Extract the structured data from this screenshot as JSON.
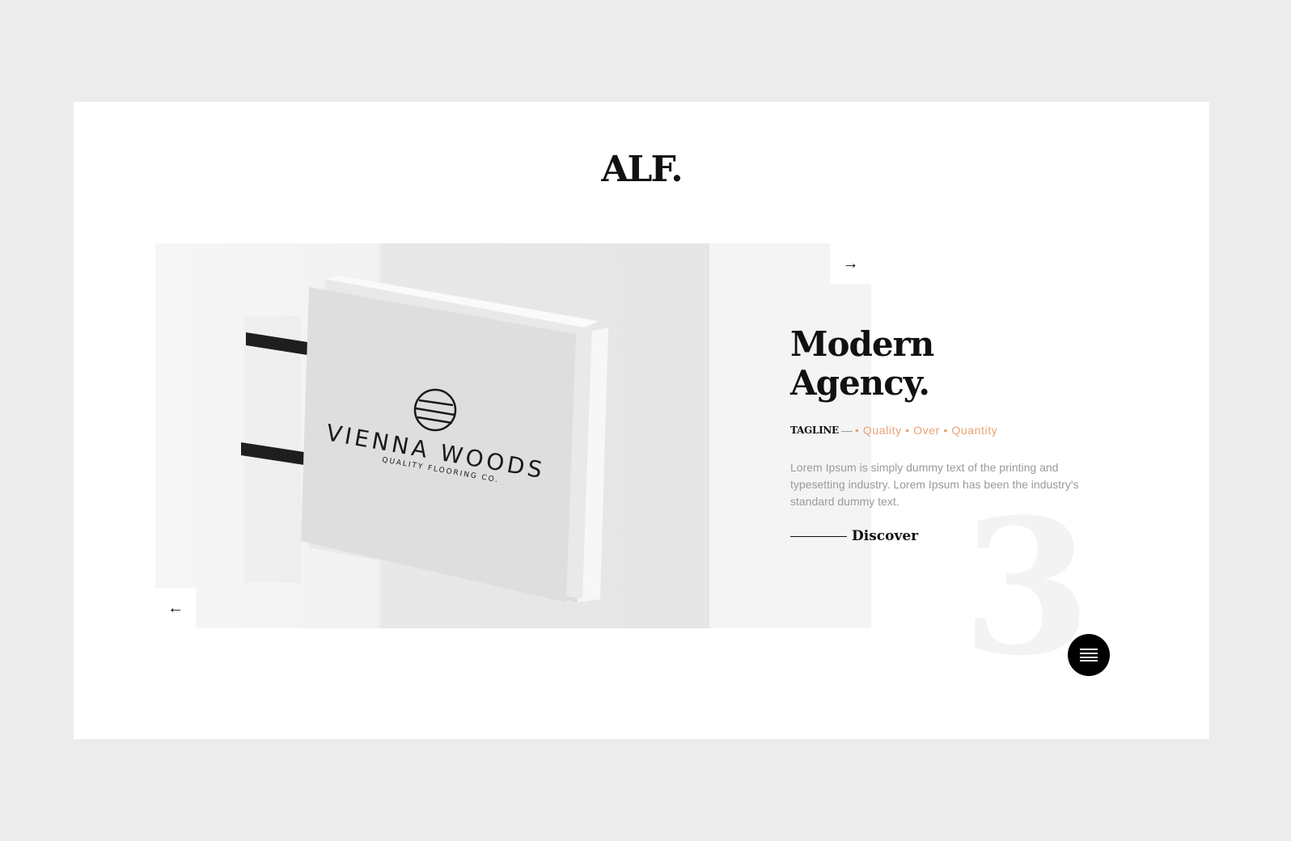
{
  "brand": {
    "logo": "ALF."
  },
  "slider": {
    "prev_icon": "←",
    "next_icon": "→",
    "current_number": "3",
    "image": {
      "sign_title": "VIENNA WOODS",
      "sign_subtitle": "QUALITY FLOORING CO."
    }
  },
  "hero": {
    "headline_line1": "Modern",
    "headline_line2": "Agency.",
    "tagline_label": "TAGLINE",
    "tagline_dash": "—",
    "tagline_words": "• Quality • Over • Quantity",
    "description": "Lorem Ipsum is simply dummy text of the printing and typesetting industry. Lorem Ipsum has been the industry's standard dummy text.",
    "discover_label": "Discover"
  },
  "icons": {
    "menu": "hamburger-icon",
    "prev": "arrow-left-icon",
    "next": "arrow-right-icon"
  },
  "colors": {
    "page_bg": "#ececec",
    "frame_bg": "#ffffff",
    "accent": "#e8a272",
    "text_dark": "#111111",
    "text_muted": "#9a9a9a"
  }
}
